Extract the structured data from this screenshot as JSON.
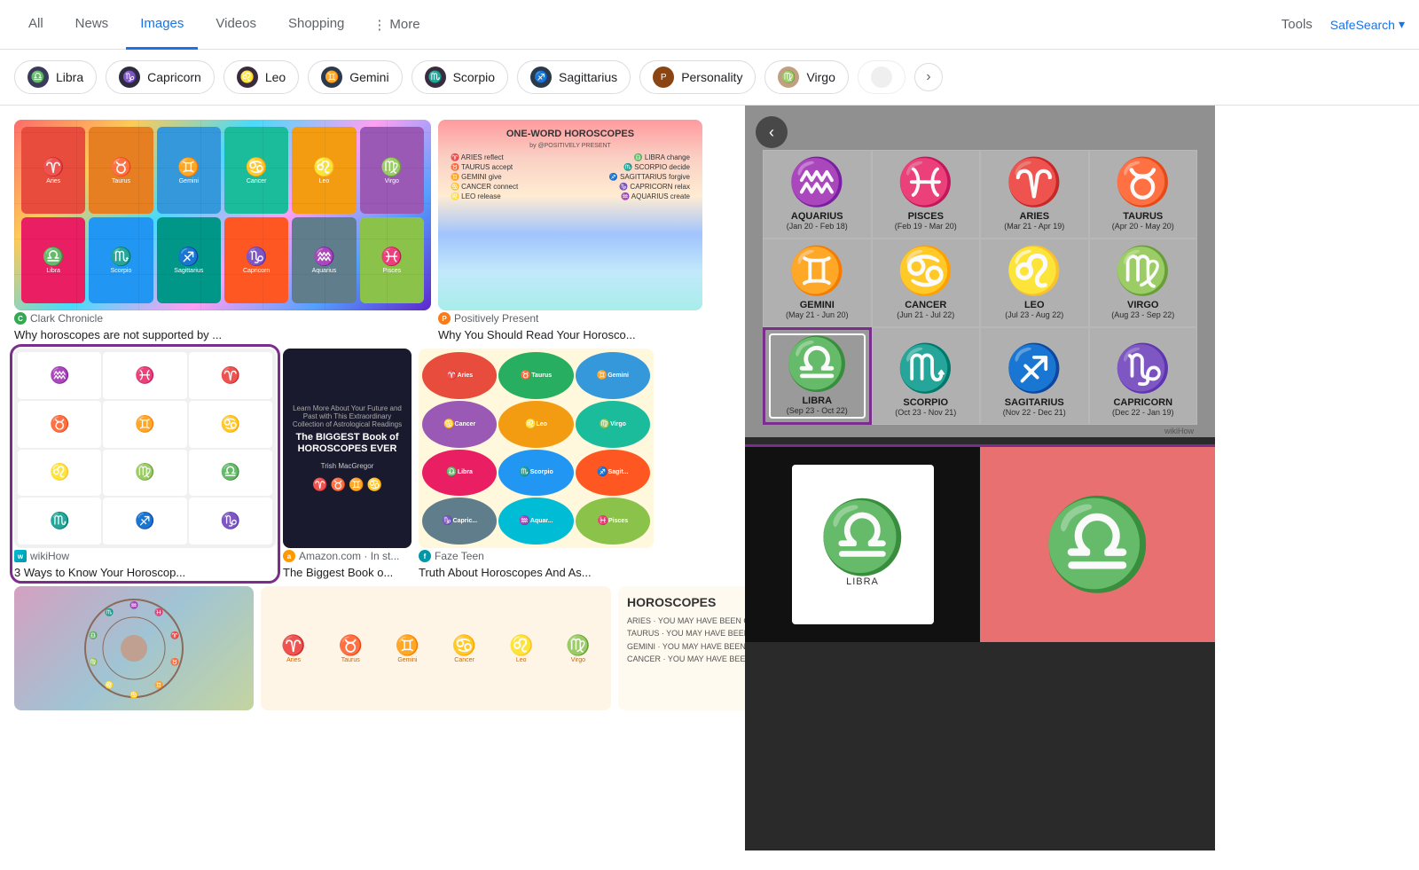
{
  "nav": {
    "items": [
      {
        "label": "All",
        "active": false
      },
      {
        "label": "News",
        "active": false
      },
      {
        "label": "Images",
        "active": true
      },
      {
        "label": "Videos",
        "active": false
      },
      {
        "label": "Shopping",
        "active": false
      },
      {
        "label": "More",
        "active": false
      }
    ],
    "tools_label": "Tools",
    "safesearch_label": "SafeSearch"
  },
  "filter_chips": [
    {
      "label": "Libra",
      "icon": "♎"
    },
    {
      "label": "Capricorn",
      "icon": "♑"
    },
    {
      "label": "Leo",
      "icon": "♌"
    },
    {
      "label": "Gemini",
      "icon": "♊"
    },
    {
      "label": "Scorpio",
      "icon": "♏"
    },
    {
      "label": "Sagittarius",
      "icon": "♐"
    },
    {
      "label": "Personality",
      "icon": "★"
    },
    {
      "label": "Virgo",
      "icon": "♍"
    }
  ],
  "results": [
    {
      "title": "Why horoscopes are not supported by ...",
      "source": "Clark Chronicle",
      "source_type": "green"
    },
    {
      "title": "Why You Should Read Your Horosco...",
      "source": "Positively Present",
      "source_type": "orange"
    },
    {
      "title": "3 Ways to Know Your Horoscop...",
      "source": "wikiHow",
      "source_type": "teal"
    },
    {
      "title": "The Biggest Book o...",
      "source": "Amazon.com · In st...",
      "source_type": "amazon"
    },
    {
      "title": "Truth About Horoscopes And As...",
      "source": "Faze Teen",
      "source_type": "teal"
    }
  ],
  "zodiac_signs": [
    {
      "name": "AQUARIUS",
      "dates": "(Jan 20 - Feb 18)",
      "symbol": "♒"
    },
    {
      "name": "PISCES",
      "dates": "(Feb 19 - Mar 20)",
      "symbol": "♓"
    },
    {
      "name": "ARIES",
      "dates": "(Mar 21 - Apr 19)",
      "symbol": "♈"
    },
    {
      "name": "TAURUS",
      "dates": "(Apr 20 - May 20)",
      "symbol": "♉"
    },
    {
      "name": "GEMINI",
      "dates": "(May 21 - Jun 20)",
      "symbol": "♊"
    },
    {
      "name": "CANCER",
      "dates": "(Jun 21 - Jul 22)",
      "symbol": "♋"
    },
    {
      "name": "LEO",
      "dates": "(Jul 23 - Aug 22)",
      "symbol": "♌"
    },
    {
      "name": "VIRGO",
      "dates": "(Aug 23 - Sep 22)",
      "symbol": "♍"
    },
    {
      "name": "LIBRA",
      "dates": "(Sep 23 - Oct 22)",
      "symbol": "♎",
      "highlight": true
    },
    {
      "name": "SCORPIO",
      "dates": "(Oct 23 - Nov 21)",
      "symbol": "♏"
    },
    {
      "name": "SAGITARIUS",
      "dates": "(Nov 22 - Dec 21)",
      "symbol": "♐"
    },
    {
      "name": "CAPRICORN",
      "dates": "(Dec 22 - Jan 19)",
      "symbol": "♑"
    }
  ],
  "one_word": {
    "title": "ONE-WORD HOROSCOPES",
    "subtitle": "by @POSITIVELY PRESENT",
    "rows": [
      {
        "left": "♈ ARIES reflect",
        "right": "♎ LIBRA change"
      },
      {
        "left": "♉ TAURUS accept",
        "right": "♏ SCORPIO decide"
      },
      {
        "left": "♊ GEMINI give",
        "right": "♐ SAGITTARIUS forgive"
      },
      {
        "left": "♋ CANCER connect",
        "right": "♑ CAPRICORN relax"
      },
      {
        "left": "♌ LEO release",
        "right": "♒ AQUARIUS create"
      }
    ]
  },
  "back_arrow": "‹",
  "libra_label": "LIBRA"
}
